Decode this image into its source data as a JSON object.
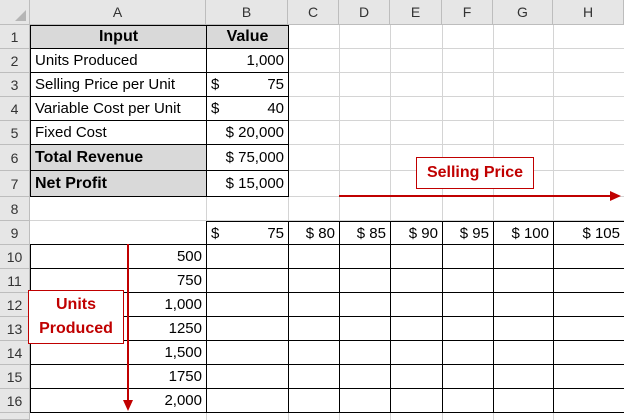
{
  "columns": [
    "A",
    "B",
    "C",
    "D",
    "E",
    "F",
    "G",
    "H"
  ],
  "rows": [
    "1",
    "2",
    "3",
    "4",
    "5",
    "6",
    "7",
    "8",
    "9",
    "10",
    "11",
    "12",
    "13",
    "14",
    "15",
    "16"
  ],
  "input_table": {
    "header_label": "Input",
    "header_value": "Value",
    "units_produced_label": "Units Produced",
    "units_produced_value": "1,000",
    "selling_price_label": "Selling Price per Unit",
    "selling_price_currency": "$",
    "selling_price_value": "75",
    "variable_cost_label": "Variable Cost per Unit",
    "variable_cost_currency": "$",
    "variable_cost_value": "40",
    "fixed_cost_label": "Fixed Cost",
    "fixed_cost_value": "$ 20,000",
    "total_revenue_label": "Total Revenue",
    "total_revenue_value": "$ 75,000",
    "net_profit_label": "Net Profit",
    "net_profit_value": "$ 15,000"
  },
  "price_row": {
    "b9_currency": "$",
    "b9_value": "75",
    "prices": [
      "$ 80",
      "$ 85",
      "$ 90",
      "$ 95",
      "$ 100",
      "$ 105"
    ]
  },
  "units_col": [
    "500",
    "750",
    "1,000",
    "1250",
    "1,500",
    "1750",
    "2,000"
  ],
  "callouts": {
    "selling_price": "Selling Price",
    "units_line1": "Units",
    "units_line2": "Produced"
  },
  "colors": {
    "header_bg": "#e6e6e6",
    "highlight": "#d9d9d9",
    "accent": "#c00000"
  }
}
